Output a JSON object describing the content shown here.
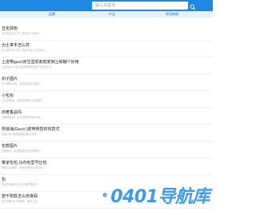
{
  "header": {
    "search_placeholder": "输入关键词"
  },
  "tabs": [
    {
      "label": "品牌"
    },
    {
      "label": "产品"
    },
    {
      "label": "资讯新闻"
    }
  ],
  "items": [
    {
      "title": "丑包掉色",
      "desc": "丑包掉色怎么办？看完这个就懂了..."
    },
    {
      "title": "为士革丰怎么样",
      "desc": "为士革丰怎么样？品牌介绍与产品评价..."
    },
    {
      "title": "土皮带gucci双生登凯莉款复制土和棚个好用",
      "desc": "土皮带gucci双生登凯莉款的选购与鉴别方法..."
    },
    {
      "title": "扣子图片",
      "desc": "扣子图片大全，各种款式扣子图片..."
    },
    {
      "title": "小包包",
      "desc": "小包包推荐，百搭实用的小包包款式..."
    },
    {
      "title": "商奢香品吗",
      "desc": "商奢香品吗？关于品牌的详细介绍..."
    },
    {
      "title": "男装海(Gucci )皮带男款的有款式",
      "desc": "男装Gucci皮带男款的款式大全..."
    },
    {
      "title": "包款图片",
      "desc": "包款图片，精选各类流行包款图片..."
    },
    {
      "title": "推家包包,马布色里号仕包",
      "desc": "推家包包推荐，马布色里号仕包评测..."
    },
    {
      "title": "包·",
      "desc": "包包的保养方法与日常护理技巧..."
    },
    {
      "title": "若干购款怎么辨真假",
      "desc": "若干购款怎么辨真假，教你几招..."
    }
  ],
  "watermark": {
    "text": "0401导航库",
    "icon": "logo-shield-icon",
    "color": "#1e88e5"
  }
}
